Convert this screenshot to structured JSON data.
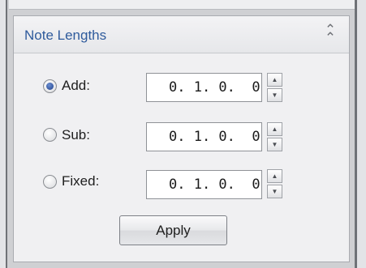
{
  "panel": {
    "title": "Note Lengths",
    "collapse_icon": "chevron-double-up-icon"
  },
  "rows": [
    {
      "label": "Add:",
      "value": "0. 1. 0.  0",
      "selected": true
    },
    {
      "label": "Sub:",
      "value": "0. 1. 0.  0",
      "selected": false
    },
    {
      "label": "Fixed:",
      "value": "0. 1. 0.  0",
      "selected": false
    }
  ],
  "apply_label": "Apply",
  "colors": {
    "title": "#2f5b9c",
    "radio_selected": "#1f3f8a"
  }
}
